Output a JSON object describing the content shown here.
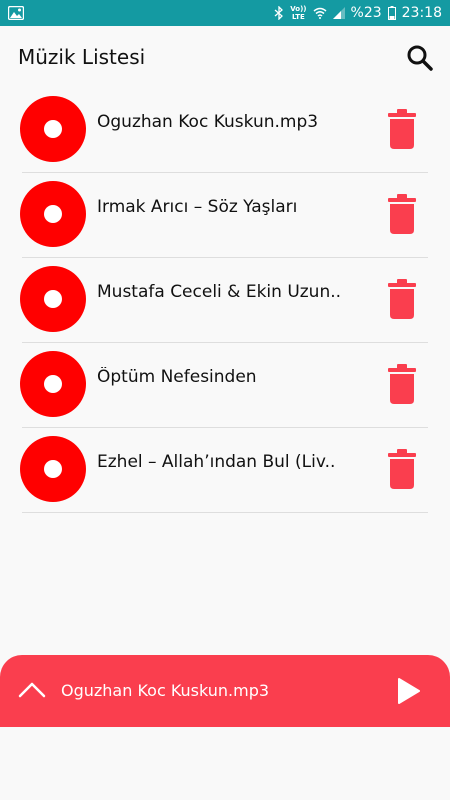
{
  "status_bar": {
    "battery": "%23",
    "time": "23:18",
    "network_top": "Vo))",
    "network_bottom": "LTE",
    "icons": [
      "image-icon",
      "bluetooth-icon",
      "wifi-icon",
      "signal-icon",
      "battery-icon"
    ]
  },
  "app_bar": {
    "title": "Müzik Listesi",
    "search_icon": "search-icon"
  },
  "songs": [
    {
      "title": "Oguzhan Koc Kuskun.mp3"
    },
    {
      "title": "Irmak Arıcı – Söz Yaşları"
    },
    {
      "title": "Mustafa Ceceli & Ekin Uzun.."
    },
    {
      "title": "Öptüm Nefesinden"
    },
    {
      "title": "Ezhel – Allah’ından Bul (Liv.."
    }
  ],
  "player": {
    "now_playing": "Oguzhan Koc Kuskun.mp3"
  },
  "colors": {
    "status_bar": "#149aa2",
    "accent": "#fa3e4e",
    "disc": "#ff0000",
    "background": "#f9f9f9"
  }
}
